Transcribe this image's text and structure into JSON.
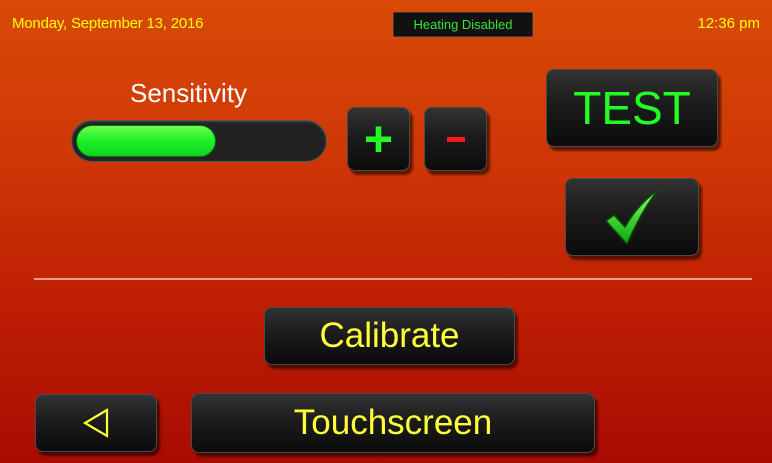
{
  "header": {
    "date": "Monday, September 13, 2016",
    "status": "Heating Disabled",
    "time": "12:36 pm"
  },
  "sensitivity": {
    "label": "Sensitivity",
    "level_fraction": 0.57,
    "fill_color": "#22f02c"
  },
  "buttons": {
    "increase_label": "+",
    "decrease_icon": "minus-icon",
    "test_label": "TEST",
    "confirm_icon": "checkmark-icon",
    "calibrate_label": "Calibrate",
    "back_icon": "back-triangle-icon",
    "touchscreen_label": "Touchscreen"
  },
  "colors": {
    "accent_yellow": "#ffff3a",
    "accent_green": "#22ff22",
    "accent_red": "#ff1a1a",
    "background": "#cf3606"
  }
}
